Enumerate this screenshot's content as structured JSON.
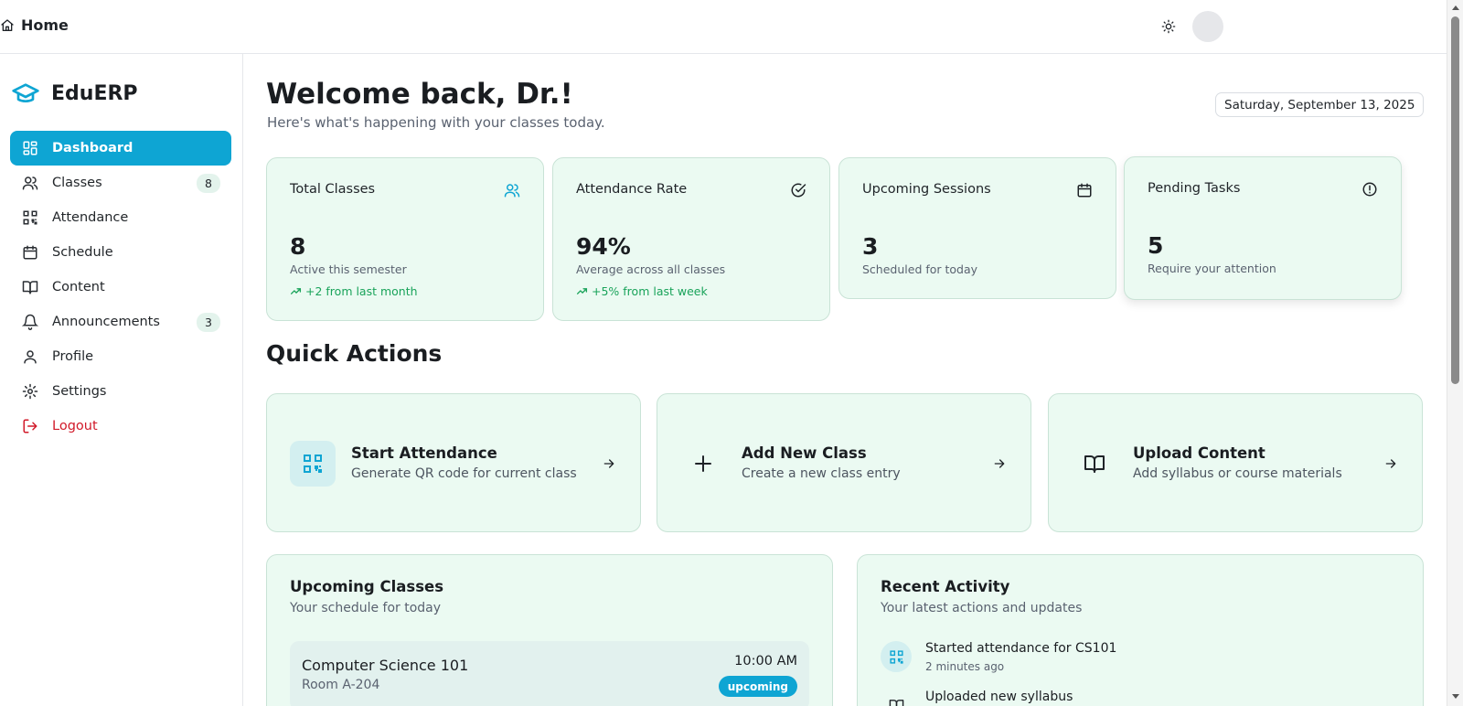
{
  "colors": {
    "accent": "#0ea5d3",
    "card_bg": "#ebfaf2",
    "trend_green": "#19a35a",
    "logout_red": "#d11a2a"
  },
  "topbar": {
    "home_label": "Home",
    "home_icon": "home-icon",
    "theme_icon": "sun-icon"
  },
  "sidebar": {
    "brand": "EduERP",
    "brand_icon": "graduation-cap-icon",
    "items": [
      {
        "label": "Dashboard",
        "icon": "layout-dashboard-icon",
        "active": true
      },
      {
        "label": "Classes",
        "icon": "users-icon",
        "badge": "8"
      },
      {
        "label": "Attendance",
        "icon": "qr-code-icon"
      },
      {
        "label": "Schedule",
        "icon": "calendar-icon"
      },
      {
        "label": "Content",
        "icon": "book-open-icon"
      },
      {
        "label": "Announcements",
        "icon": "bell-icon",
        "badge": "3"
      },
      {
        "label": "Profile",
        "icon": "user-icon"
      },
      {
        "label": "Settings",
        "icon": "gear-icon"
      },
      {
        "label": "Logout",
        "icon": "logout-icon"
      }
    ]
  },
  "header": {
    "welcome": "Welcome back, Dr.!",
    "subtitle": "Here's what's happening with your classes today.",
    "date": "Saturday, September 13, 2025"
  },
  "stats": [
    {
      "title": "Total Classes",
      "value": "8",
      "desc": "Active this semester",
      "trend": "+2 from last month",
      "icon": "users-icon"
    },
    {
      "title": "Attendance Rate",
      "value": "94%",
      "desc": "Average across all classes",
      "trend": "+5% from last week",
      "icon": "check-circle-icon"
    },
    {
      "title": "Upcoming Sessions",
      "value": "3",
      "desc": "Scheduled for today",
      "icon": "calendar-icon"
    },
    {
      "title": "Pending Tasks",
      "value": "5",
      "desc": "Require your attention",
      "icon": "alert-circle-icon"
    }
  ],
  "quick_actions": {
    "title": "Quick Actions",
    "items": [
      {
        "title": "Start Attendance",
        "desc": "Generate QR code for current class",
        "icon": "qr-code-icon"
      },
      {
        "title": "Add New Class",
        "desc": "Create a new class entry",
        "icon": "plus-icon"
      },
      {
        "title": "Upload Content",
        "desc": "Add syllabus or course materials",
        "icon": "book-open-icon"
      }
    ]
  },
  "upcoming_classes": {
    "title": "Upcoming Classes",
    "subtitle": "Your schedule for today",
    "items": [
      {
        "name": "Computer Science 101",
        "room": "Room A-204",
        "time": "10:00 AM",
        "status": "upcoming"
      }
    ]
  },
  "recent_activity": {
    "title": "Recent Activity",
    "subtitle": "Your latest actions and updates",
    "items": [
      {
        "text": "Started attendance for CS101",
        "time": "2 minutes ago",
        "icon": "qr-code-icon"
      },
      {
        "text": "Uploaded new syllabus",
        "icon": "book-open-icon"
      }
    ]
  }
}
